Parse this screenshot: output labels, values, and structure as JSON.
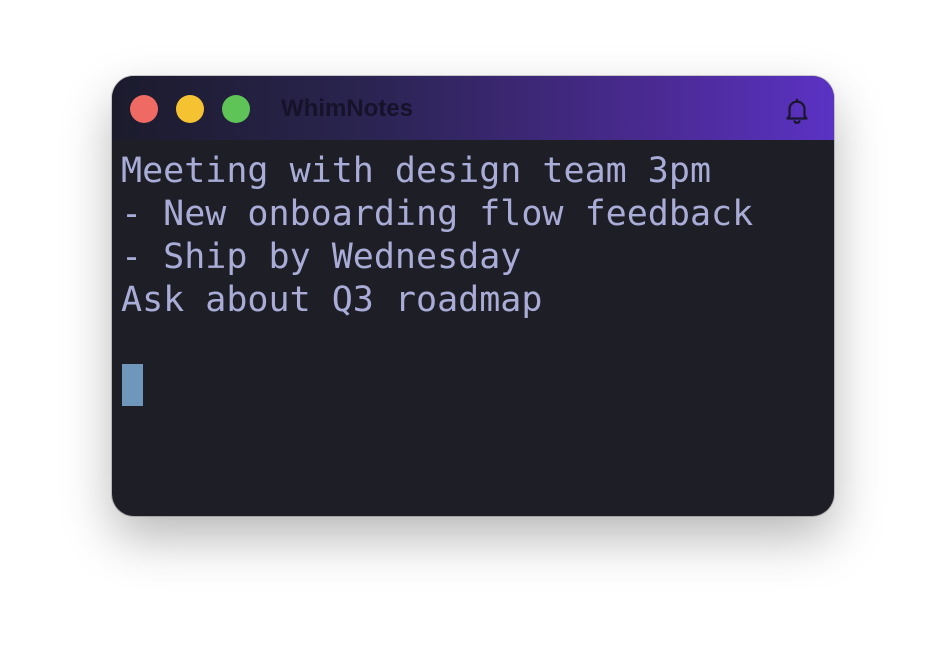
{
  "window": {
    "title": "WhimNotes"
  },
  "titlebar": {
    "buttons": {
      "close": {
        "icon": "close-dot",
        "color": "#ee6a63"
      },
      "minimize": {
        "icon": "minimize-dot",
        "color": "#f5c332"
      },
      "zoom": {
        "icon": "zoom-dot",
        "color": "#5fc457"
      }
    },
    "notification_icon": "bell-icon"
  },
  "editor": {
    "lines": [
      "Meeting with design team 3pm",
      "- New onboarding flow feedback",
      "- Ship by Wednesday",
      "Ask about Q3 roadmap",
      ""
    ],
    "text_color": "#a9acd6",
    "cursor_color": "#6e97bb"
  }
}
